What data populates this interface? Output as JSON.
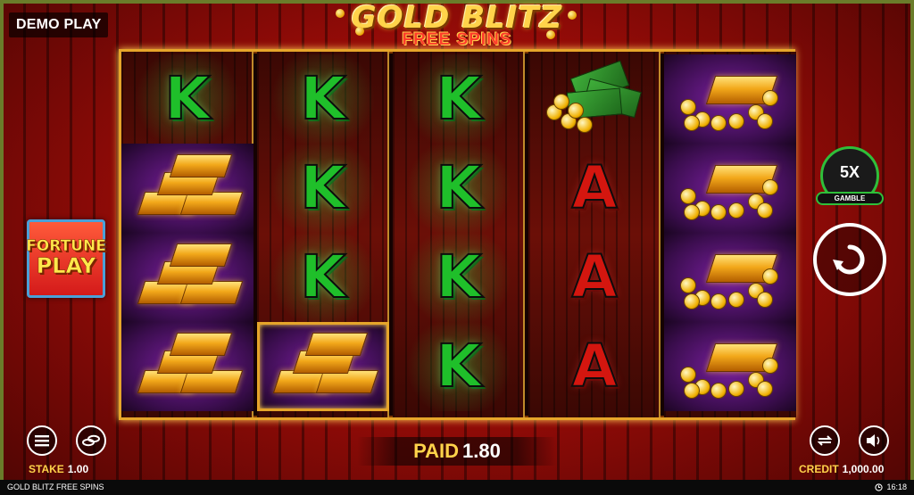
{
  "header": {
    "demo_label": "DEMO PLAY",
    "logo_title": "GOLD BLITZ",
    "logo_subtitle": "FREE SPINS"
  },
  "side": {
    "fortune_line1": "FORTUNE",
    "fortune_line2": "PLAY",
    "gamble_value": "5X",
    "gamble_label": "GAMBLE"
  },
  "reels": [
    [
      "K",
      "gold-bars",
      "gold-bars",
      "gold-bars"
    ],
    [
      "K",
      "K",
      "K",
      "gold-bars-win"
    ],
    [
      "K",
      "K",
      "K",
      "K"
    ],
    [
      "cash",
      "A",
      "A",
      "A"
    ],
    [
      "gold-bar-coins",
      "gold-bar-coins",
      "gold-bar-coins",
      "gold-bar-coins"
    ]
  ],
  "bottom": {
    "stake_label": "STAKE",
    "stake_value": "1.00",
    "paid_label": "PAID",
    "paid_value": "1.80",
    "credit_label": "CREDIT",
    "credit_value": "1,000.00"
  },
  "footer": {
    "game_name": "GOLD BLITZ FREE SPINS",
    "time": "16:18"
  },
  "colors": {
    "accent_gold": "#ffd34a",
    "reel_border": "#e6a52a",
    "gamble_ring": "#2fbf3a",
    "k_green": "#1fbf2a",
    "a_red": "#d4160f"
  },
  "icons": {
    "menu": "menu-icon",
    "stake": "stake-coins-icon",
    "autoplay": "autoplay-icon",
    "sound": "speaker-icon",
    "spin": "spin-arrow-icon",
    "clock": "clock-icon"
  }
}
